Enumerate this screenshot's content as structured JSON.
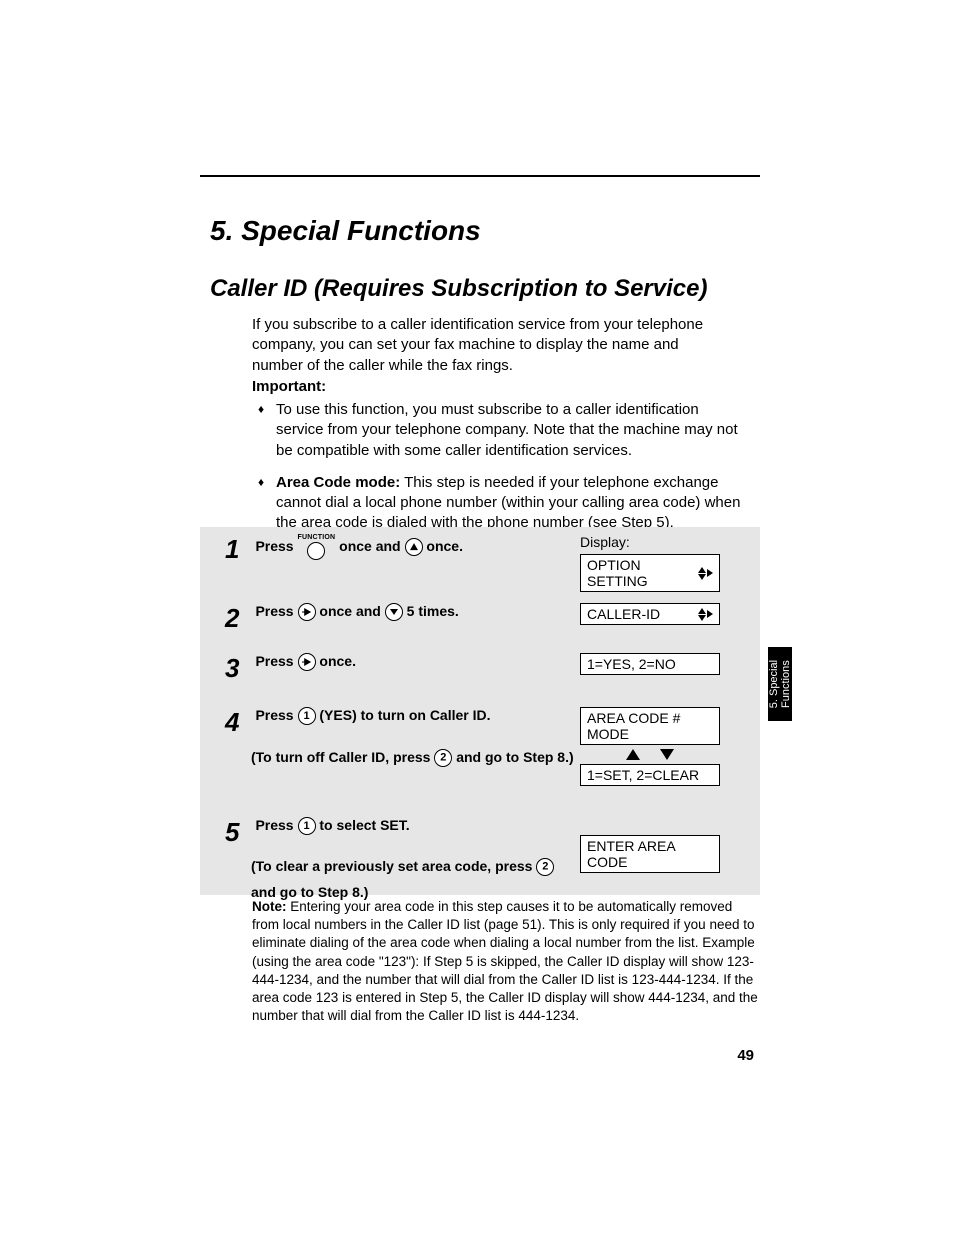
{
  "chapter_title": "5. Special Functions",
  "section_title": "Caller ID (Requires Subscription to Service)",
  "intro_paragraph": "If you subscribe to a caller identification service from your telephone company, you can set your fax machine to display the name and number of the caller while the fax rings.",
  "important_label": "Important:",
  "bullets": [
    {
      "text": "To use this function, you must subscribe to a caller identification service from your telephone company. Note that the machine may not be compatible with some caller identification services."
    },
    {
      "bold_lead": "Area Code mode:",
      "text": " This step is needed if your telephone exchange cannot dial a local phone number (within your calling area code) when the area code is dialed with the phone number (see Step 5)."
    }
  ],
  "function_btn_label": "FUNCTION",
  "display_header": "Display:",
  "steps": {
    "s1": {
      "num": "1",
      "pre": "Press ",
      "mid": " once and ",
      "post": " once.",
      "display": "OPTION SETTING"
    },
    "s2": {
      "num": "2",
      "pre": "Press ",
      "mid": " once and ",
      "post": " 5 times.",
      "display": "CALLER-ID"
    },
    "s3": {
      "num": "3",
      "pre": "Press ",
      "post": " once.",
      "display": "1=YES, 2=NO"
    },
    "s4": {
      "num": "4",
      "pre": "Press ",
      "mid": " (YES) to turn on Caller ID.",
      "sub_pre": "(To turn off Caller ID, press ",
      "sub_post": " and go to Step 8.)",
      "display_top": "AREA CODE # MODE",
      "display_bottom": "1=SET, 2=CLEAR"
    },
    "s5": {
      "num": "5",
      "pre": "Press ",
      "mid": " to select SET.",
      "sub_pre": "(To clear a previously set area code, press ",
      "sub_post": " and go to Step 8.)",
      "display": "ENTER AREA CODE"
    }
  },
  "note_bold": "Note:",
  "note_text": " Entering your area code in this step causes it to be automatically removed from local numbers in the Caller ID list (page 51). This is only required if you need to eliminate dialing of the area code when dialing a local number from the list. Example (using the area code \"123\"): If Step 5 is skipped, the Caller ID display will show 123-444-1234, and the number that will dial from the Caller ID list is 123-444-1234. If the area code 123 is entered in Step 5, the Caller ID display will show 444-1234, and the number that will dial from the Caller ID list is 444-1234.",
  "sidetab_line1": "5. Special",
  "sidetab_line2": "Functions",
  "page_number": "49",
  "btn_labels": {
    "one": "1",
    "two": "2"
  }
}
